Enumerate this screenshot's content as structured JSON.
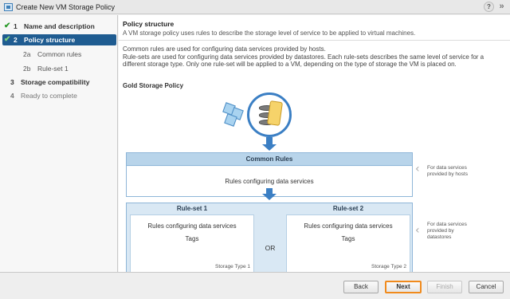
{
  "window": {
    "title": "Create New VM Storage Policy"
  },
  "sidebar": {
    "steps": [
      {
        "num": "1",
        "label": "Name and description",
        "state": "done"
      },
      {
        "num": "2",
        "label": "Policy structure",
        "state": "active"
      },
      {
        "num": "2a",
        "label": "Common rules",
        "state": "sub"
      },
      {
        "num": "2b",
        "label": "Rule-set 1",
        "state": "sub"
      },
      {
        "num": "3",
        "label": "Storage compatibility",
        "state": "pending"
      },
      {
        "num": "4",
        "label": "Ready to complete",
        "state": "dim"
      }
    ]
  },
  "content": {
    "title": "Policy structure",
    "description": "A VM storage policy uses rules to describe the storage level of service to be applied to virtual machines.",
    "para1": "Common rules are used for configuring data services provided by hosts.",
    "para2a": "Rule-sets are used for configuring data services provided by datastores. Each rule-sets describes the same level of service for a",
    "para2b": "different storage type. Only one rule-set will be applied to a VM, depending on the type of storage the VM is placed on.",
    "policy_name": "Gold Storage Policy"
  },
  "diagram": {
    "common": {
      "header": "Common Rules",
      "body": "Rules configuring data services"
    },
    "ruleset1": {
      "header": "Rule-set 1",
      "line1": "Rules configuring data services",
      "line2": "Tags",
      "type": "Storage Type 1"
    },
    "ruleset2": {
      "header": "Rule-set 2",
      "line1": "Rules configuring data services",
      "line2": "Tags",
      "type": "Storage Type 2"
    },
    "or": "OR",
    "note_hosts_1": "For data services",
    "note_hosts_2": "provided by hosts",
    "note_ds_1": "For data services",
    "note_ds_2": "provided by",
    "note_ds_3": "datastores"
  },
  "footer": {
    "back": "Back",
    "next": "Next",
    "finish": "Finish",
    "cancel": "Cancel"
  },
  "icons": {
    "help": "help-icon",
    "expand": "expand-icon",
    "check": "check-icon",
    "accent": "#1f5c91",
    "highlight": "#f08a1c"
  }
}
